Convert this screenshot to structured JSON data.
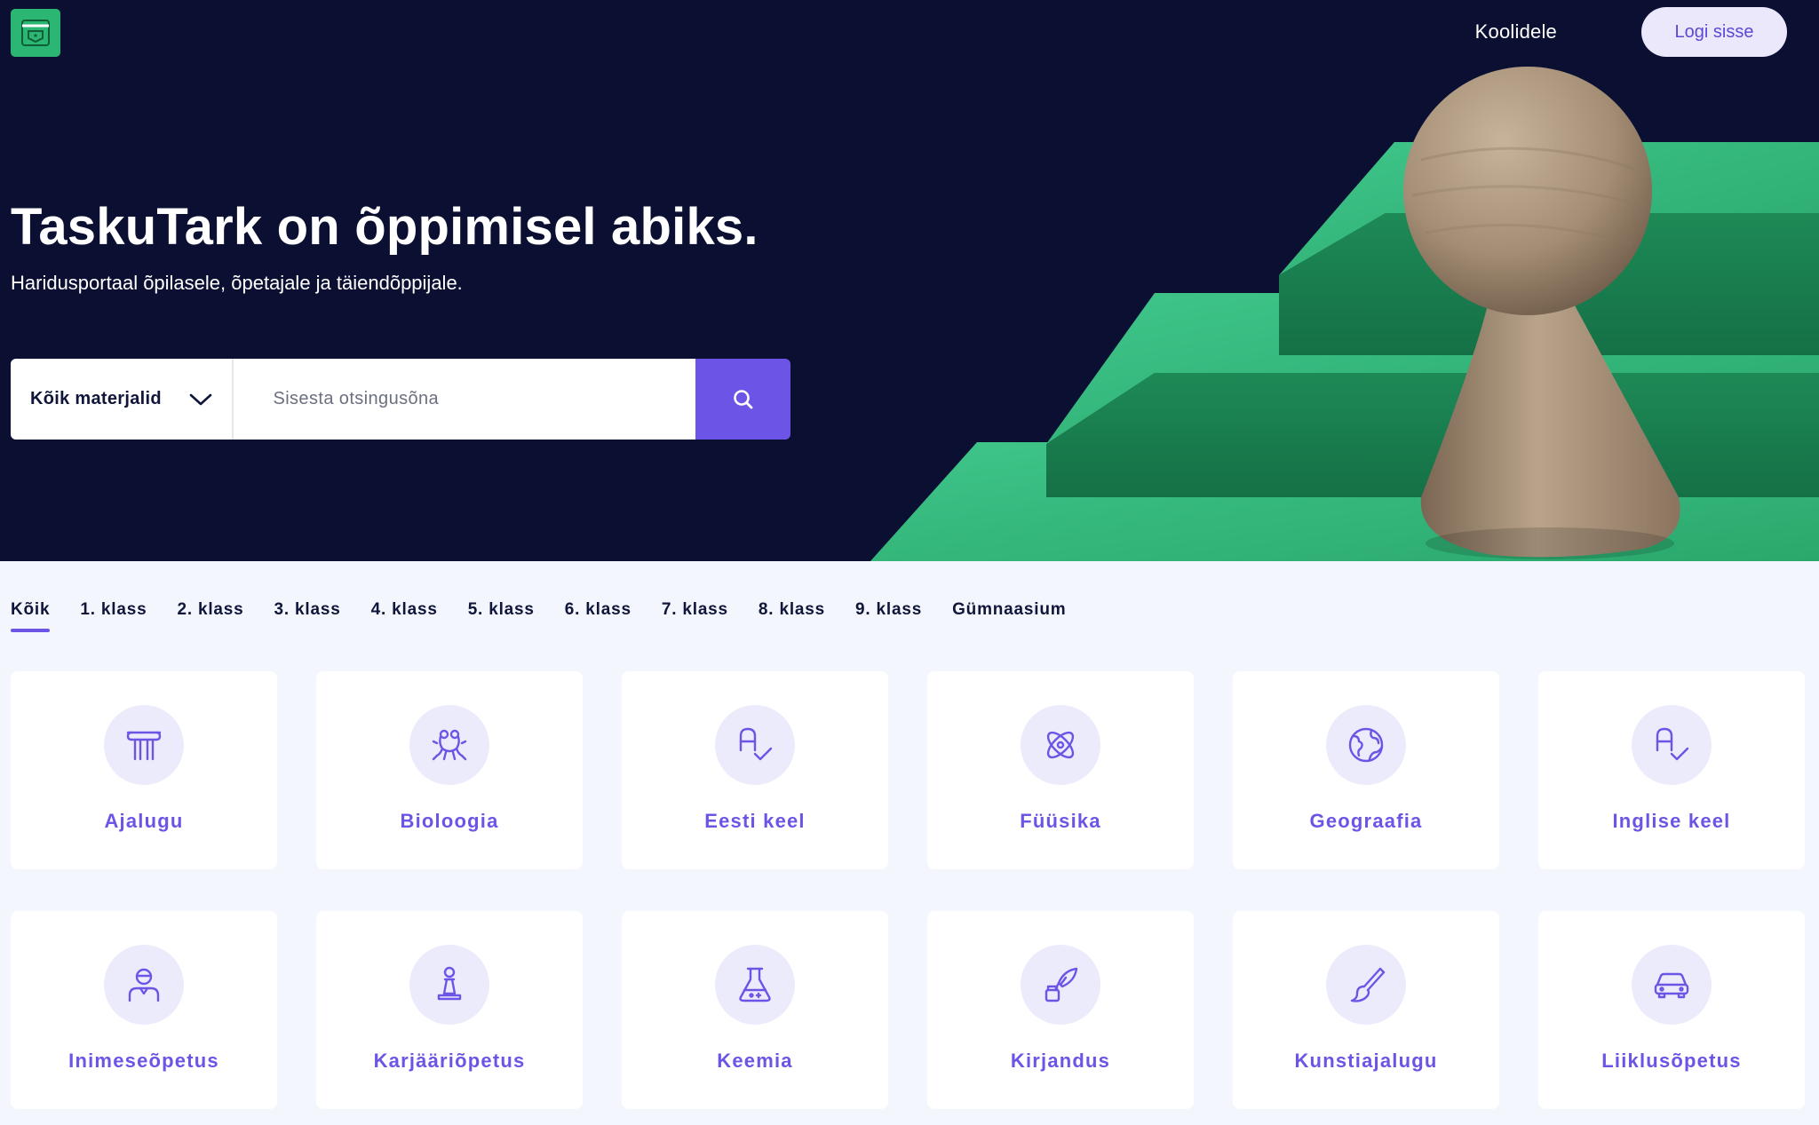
{
  "header": {
    "nav_link": "Koolidele",
    "login_label": "Logi sisse"
  },
  "hero": {
    "title": "TaskuTark on õppimisel abiks.",
    "subtitle": "Haridusportaal õpilasele, õpetajale ja täiendõppijale."
  },
  "search": {
    "select_value": "Kõik materjalid",
    "placeholder": "Sisesta otsingusõna"
  },
  "tabs": [
    "Kõik",
    "1. klass",
    "2. klass",
    "3. klass",
    "4. klass",
    "5. klass",
    "6. klass",
    "7. klass",
    "8. klass",
    "9. klass",
    "Gümnaasium"
  ],
  "subjects": [
    {
      "label": "Ajalugu",
      "icon": "column-icon"
    },
    {
      "label": "Bioloogia",
      "icon": "frog-icon"
    },
    {
      "label": "Eesti keel",
      "icon": "spellcheck-icon"
    },
    {
      "label": "Füüsika",
      "icon": "atom-icon"
    },
    {
      "label": "Geograafia",
      "icon": "globe-icon"
    },
    {
      "label": "Inglise keel",
      "icon": "spellcheck-icon"
    },
    {
      "label": "Inimeseõpetus",
      "icon": "person-icon"
    },
    {
      "label": "Karjääriõpetus",
      "icon": "chess-pawn-icon"
    },
    {
      "label": "Keemia",
      "icon": "flask-icon"
    },
    {
      "label": "Kirjandus",
      "icon": "quill-ink-icon"
    },
    {
      "label": "Kunstiajalugu",
      "icon": "paintbrush-icon"
    },
    {
      "label": "Liiklusõpetus",
      "icon": "car-icon"
    }
  ],
  "colors": {
    "hero_bg": "#0b1033",
    "accent": "#6c55e6",
    "brand_green": "#2bb673",
    "page_bg": "#f4f6fd"
  }
}
